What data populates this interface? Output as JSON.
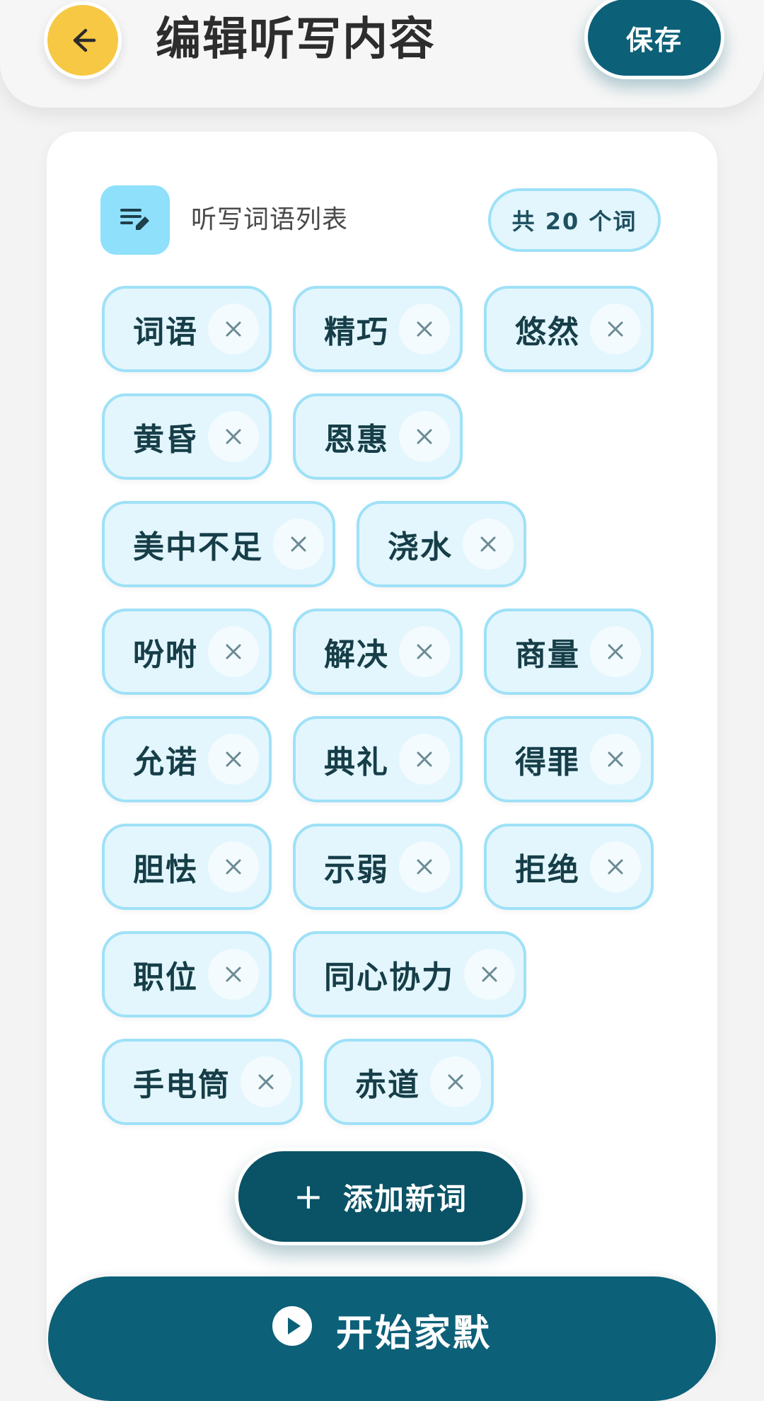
{
  "header": {
    "title": "编辑听写内容",
    "save_label": "保存",
    "back_icon": "arrow-left-icon"
  },
  "list": {
    "icon": "list-edit-icon",
    "title": "听写词语列表",
    "count_label": "共 20 个词"
  },
  "words": [
    "词语",
    "精巧",
    "悠然",
    "黄昏",
    "恩惠",
    "美中不足",
    "浇水",
    "吩咐",
    "解决",
    "商量",
    "允诺",
    "典礼",
    "得罪",
    "胆怯",
    "示弱",
    "拒绝",
    "职位",
    "同心协力",
    "手电筒",
    "赤道"
  ],
  "actions": {
    "add_icon": "plus",
    "add_label": "添加新词",
    "start_label": "开始家默",
    "start_icon": "play-icon"
  },
  "colors": {
    "primary": "#0c6078",
    "accent": "#f7c843",
    "chip_bg": "#e3f6fd",
    "chip_border": "#9fe1f7"
  }
}
